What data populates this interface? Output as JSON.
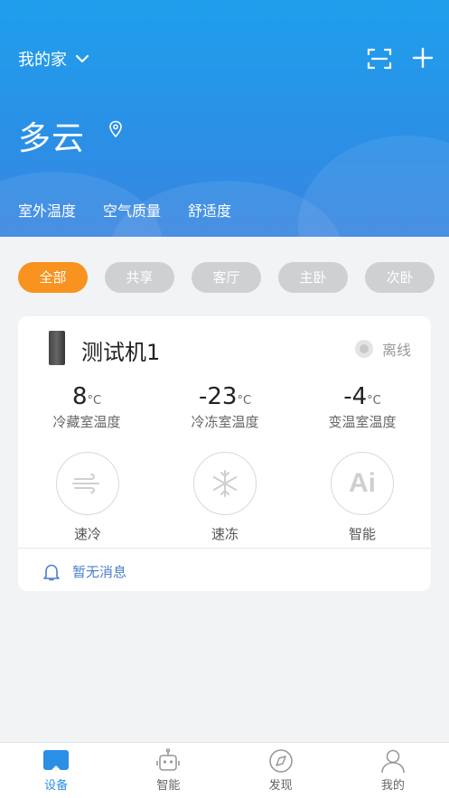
{
  "header": {
    "home_label": "我的家",
    "weather": "多云",
    "metrics": [
      "室外温度",
      "空气质量",
      "舒适度"
    ]
  },
  "filters": [
    "全部",
    "共享",
    "客厅",
    "主卧",
    "次卧"
  ],
  "device": {
    "name": "测试机1",
    "status": "离线",
    "temps": [
      {
        "value": "8",
        "unit": "°C",
        "label": "冷藏室温度"
      },
      {
        "value": "-23",
        "unit": "°C",
        "label": "冷冻室温度"
      },
      {
        "value": "-4",
        "unit": "°C",
        "label": "变温室温度"
      }
    ],
    "modes": [
      {
        "icon": "wind-icon",
        "label": "速冷"
      },
      {
        "icon": "snowflake-icon",
        "label": "速冻"
      },
      {
        "icon": "ai-icon",
        "label": "智能",
        "icon_text": "Ai"
      }
    ],
    "message": "暂无消息"
  },
  "nav": [
    {
      "icon": "device-icon",
      "label": "设备",
      "active": true
    },
    {
      "icon": "robot-icon",
      "label": "智能"
    },
    {
      "icon": "compass-icon",
      "label": "发现"
    },
    {
      "icon": "user-icon",
      "label": "我的"
    }
  ],
  "colors": {
    "primary": "#2b8fe6",
    "accent": "#f7931e",
    "chip_inactive": "#cfd0d2"
  }
}
